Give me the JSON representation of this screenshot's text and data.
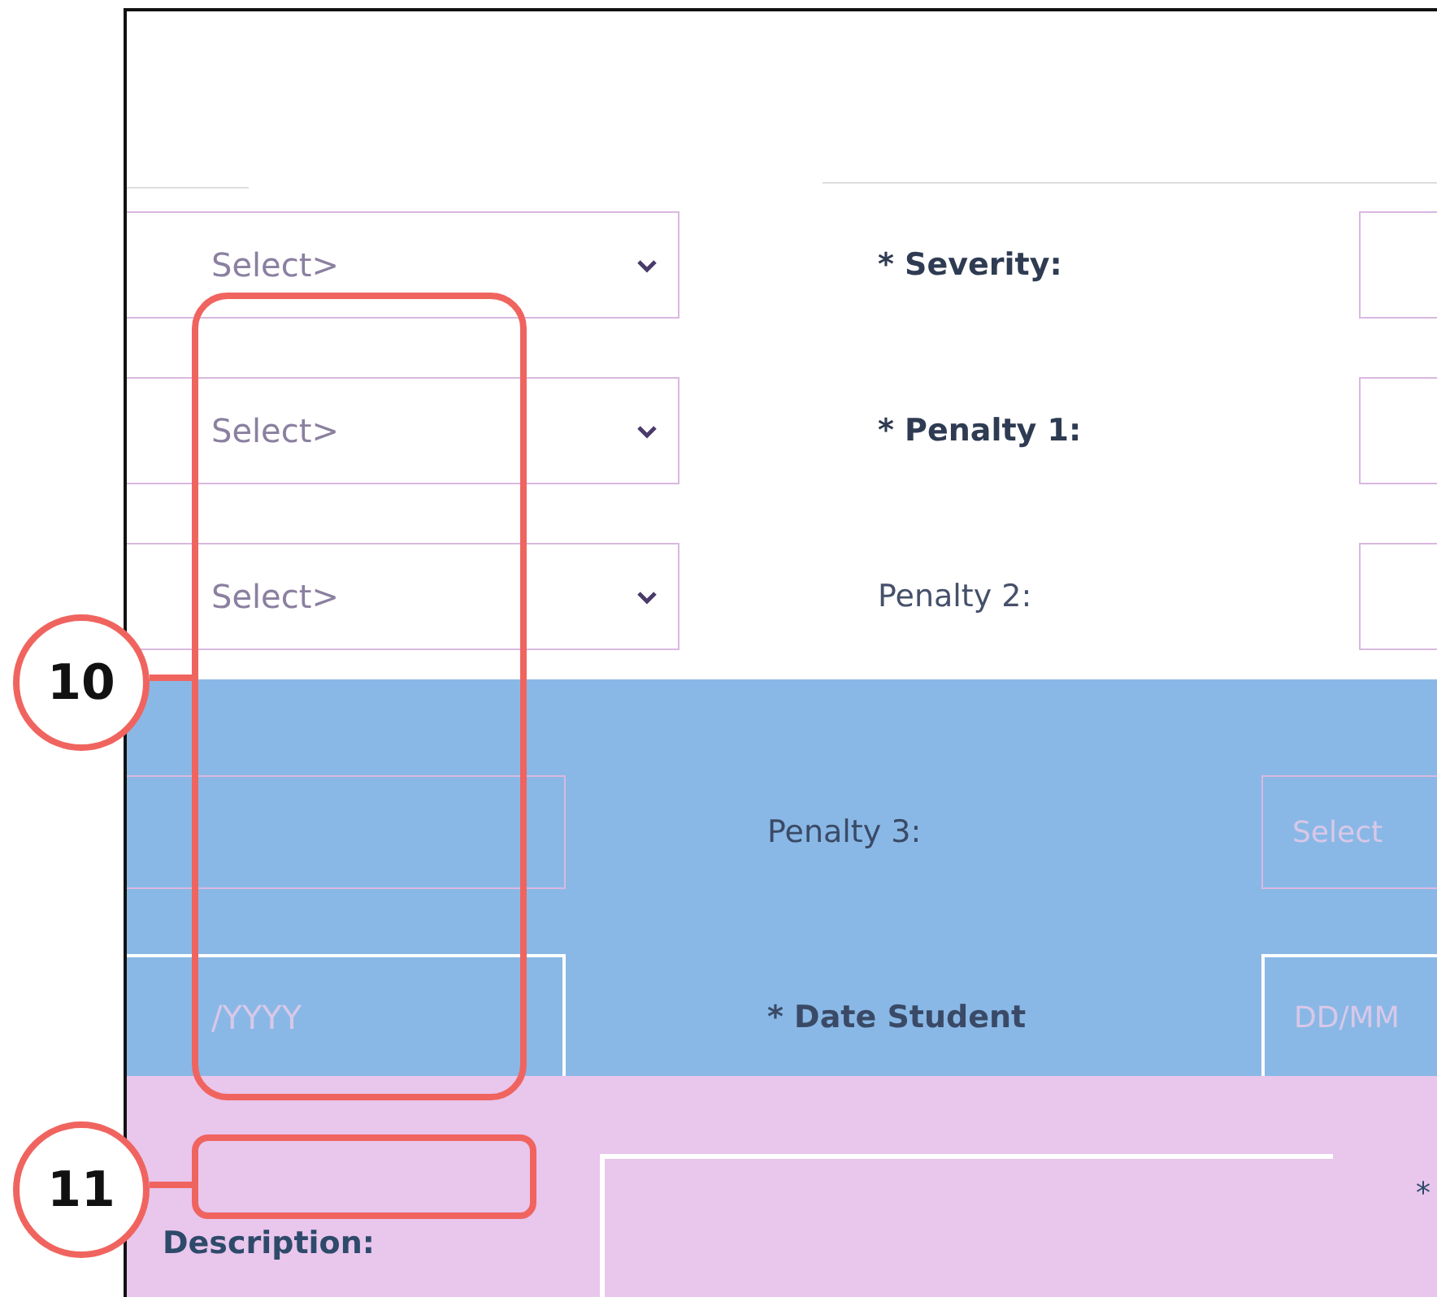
{
  "upper_rows": [
    {
      "left_select": "Select>",
      "label": "* Severity:"
    },
    {
      "left_select": "Select>",
      "label": "* Penalty 1:"
    },
    {
      "left_select": "Select>",
      "label": "Penalty 2:"
    }
  ],
  "highlighted_rows": [
    {
      "left_value": "",
      "label": "Penalty 3:",
      "right_value": "Select",
      "kind": "select"
    },
    {
      "left_value": "/YYYY",
      "label": "* Date Student",
      "right_value": "DD/MM",
      "kind": "date"
    }
  ],
  "description": {
    "label": "Description:",
    "required_mark": "*"
  },
  "callouts": [
    {
      "number": "10"
    },
    {
      "number": "11"
    }
  ]
}
